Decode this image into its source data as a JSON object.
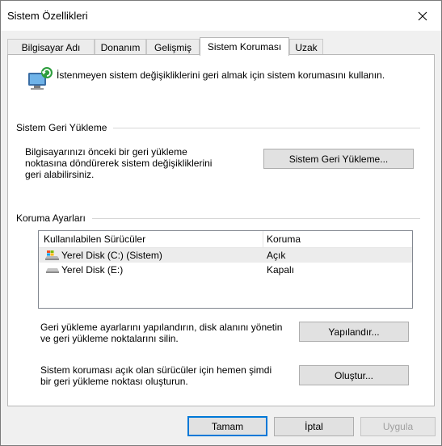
{
  "window": {
    "title": "Sistem Özellikleri"
  },
  "tabs": [
    {
      "label": "Bilgisayar Adı"
    },
    {
      "label": "Donanım"
    },
    {
      "label": "Gelişmiş"
    },
    {
      "label": "Sistem Koruması"
    },
    {
      "label": "Uzak"
    }
  ],
  "intro": {
    "text": "İstenmeyen sistem değişikliklerini geri almak için sistem korumasını kullanın."
  },
  "restore_group": {
    "label": "Sistem Geri Yükleme",
    "description": "Bilgisayarınızı önceki bir geri yükleme noktasına döndürerek sistem değişikliklerini geri alabilirsiniz.",
    "button_label": "Sistem Geri Yükleme..."
  },
  "protection_group": {
    "label": "Koruma Ayarları",
    "columns": [
      "Kullanılabilen Sürücüler",
      "Koruma"
    ],
    "drives": [
      {
        "name": "Yerel Disk (C:) (Sistem)",
        "protection": "Açık",
        "icon": "system-drive-icon"
      },
      {
        "name": "Yerel Disk (E:)",
        "protection": "Kapalı",
        "icon": "drive-icon"
      }
    ],
    "configure_description": "Geri yükleme ayarlarını yapılandırın, disk alanını yönetin ve geri yükleme noktalarını silin.",
    "configure_button": "Yapılandır...",
    "create_description": "Sistem koruması açık olan sürücüler için hemen şimdi bir geri yükleme noktası oluşturun.",
    "create_button": "Oluştur..."
  },
  "footer": {
    "ok": "Tamam",
    "cancel": "İptal",
    "apply": "Uygula"
  },
  "colors": {
    "accent": "#0078d7",
    "selection": "#ececec"
  }
}
